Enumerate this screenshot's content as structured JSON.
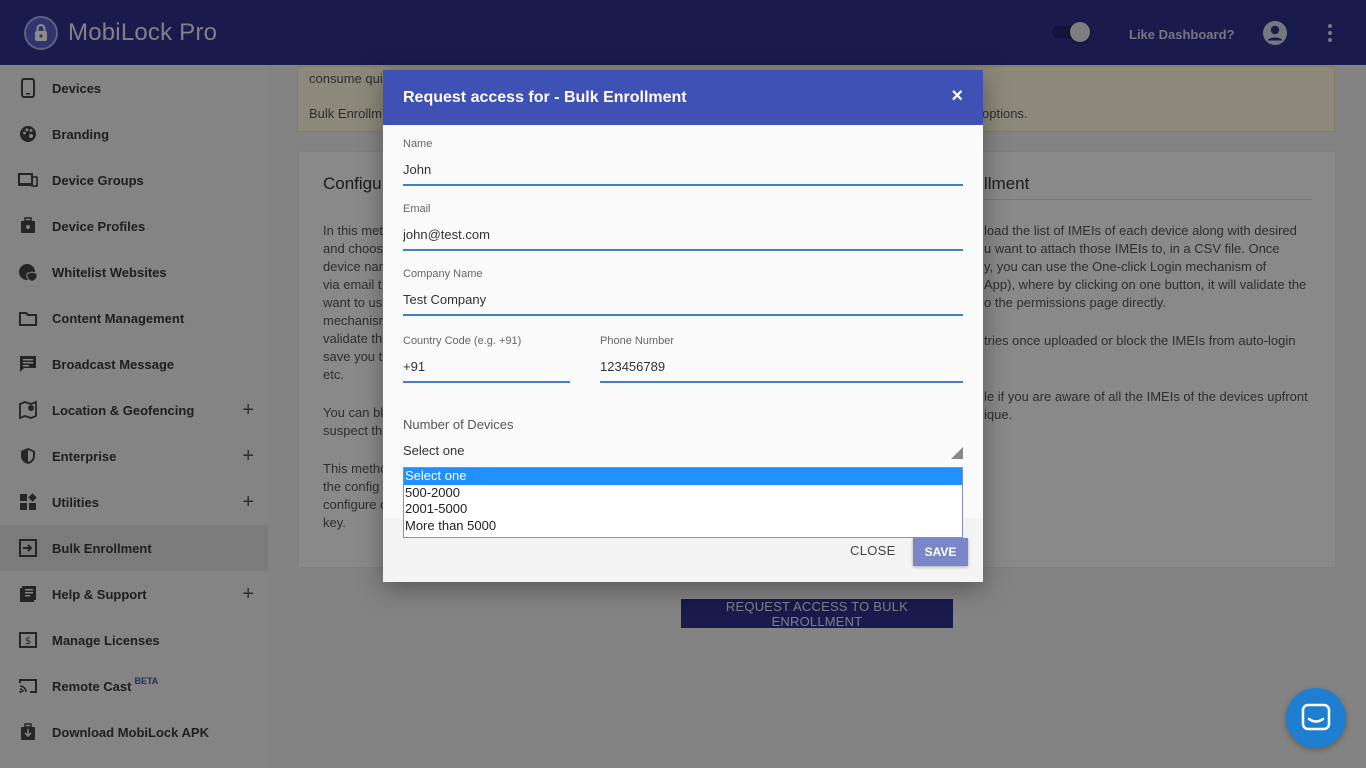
{
  "app": {
    "title": "MobiLock Pro",
    "like_dashboard": "Like Dashboard?"
  },
  "sidebar": {
    "items": [
      {
        "label": "Devices",
        "icon": "phone-icon",
        "expandable": false
      },
      {
        "label": "Branding",
        "icon": "palette-icon",
        "expandable": false
      },
      {
        "label": "Device Groups",
        "icon": "devices-icon",
        "expandable": false
      },
      {
        "label": "Device Profiles",
        "icon": "briefcase-icon",
        "expandable": false
      },
      {
        "label": "Whitelist Websites",
        "icon": "globe-shield-icon",
        "expandable": false
      },
      {
        "label": "Content Management",
        "icon": "folder-icon",
        "expandable": false
      },
      {
        "label": "Broadcast Message",
        "icon": "message-icon",
        "expandable": false
      },
      {
        "label": "Location & Geofencing",
        "icon": "map-pin-icon",
        "expandable": true
      },
      {
        "label": "Enterprise",
        "icon": "shield-icon",
        "expandable": true
      },
      {
        "label": "Utilities",
        "icon": "widgets-icon",
        "expandable": true
      },
      {
        "label": "Bulk Enrollment",
        "icon": "enroll-icon",
        "expandable": false,
        "active": true
      },
      {
        "label": "Help & Support",
        "icon": "help-book-icon",
        "expandable": true
      },
      {
        "label": "Manage Licenses",
        "icon": "license-icon",
        "expandable": false
      },
      {
        "label": "Remote Cast",
        "icon": "cast-icon",
        "expandable": false,
        "badge": "BETA"
      },
      {
        "label": "Download MobiLock APK",
        "icon": "download-icon",
        "expandable": false
      }
    ],
    "plus": "+"
  },
  "background": {
    "notice_line1": "consume qui",
    "notice_line2_left": "Bulk Enrollm",
    "notice_line2_right": "options.",
    "card_title_left": "Configu",
    "card_title_right": "llment",
    "left_paragraph_1": [
      "In this met",
      "and choos",
      "device nam",
      "via email t",
      "want to us",
      "mechanism",
      "validate th",
      "save you th",
      "etc."
    ],
    "left_paragraph_2": [
      "You can bl",
      "suspect th"
    ],
    "left_paragraph_3": [
      "This metho",
      "the config",
      "configure o",
      "key."
    ],
    "right_paragraph_1": [
      "load the list of IMEIs of each device along with desired",
      "u want to attach those IMEIs to, in a CSV file. Once",
      "y, you can use the One-click Login mechanism of",
      "App), where by clicking on one button, it will validate the",
      "o the permissions page directly."
    ],
    "right_paragraph_2": "tries once uploaded or block the IMEIs from auto-login",
    "right_paragraph_3": [
      "le if you are aware of all the IMEIs of the devices upfront",
      "ique."
    ],
    "request_button": "REQUEST ACCESS TO BULK ENROLLMENT"
  },
  "modal": {
    "title": "Request access for - Bulk Enrollment",
    "close_symbol": "×",
    "name_label": "Name",
    "name_value": "John",
    "email_label": "Email",
    "email_value": "john@test.com",
    "company_label": "Company Name",
    "company_value": "Test Company",
    "country_code_label": "Country Code (e.g. +91)",
    "country_code_value": "+91",
    "phone_label": "Phone Number",
    "phone_value": "123456789",
    "devices_label": "Number of Devices",
    "devices_value": "Select one",
    "devices_options": [
      "Select one",
      "500-2000",
      "2001-5000",
      "More than 5000"
    ],
    "close_button": "CLOSE",
    "save_button": "SAVE"
  },
  "colors": {
    "topbar": "#2d3289",
    "modal_header": "#3f51b5",
    "accent_line": "#3f7fc4",
    "save_button": "#7b86c9",
    "dropdown_selected": "#1e90ff",
    "chat": "#1e7fd1"
  }
}
